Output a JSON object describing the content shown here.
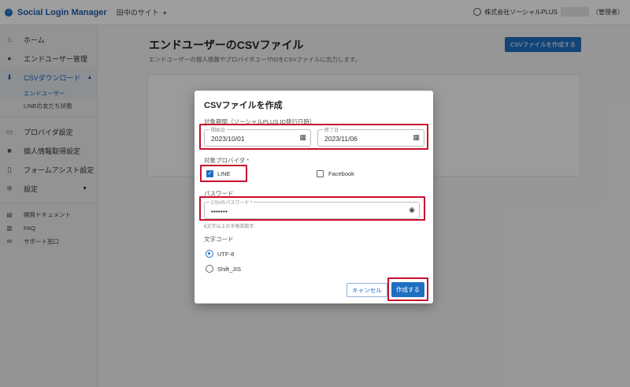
{
  "header": {
    "app_title": "Social Login Manager",
    "site_name": "田中のサイト",
    "account_company": "株式会社ソーシャルPLUS",
    "account_role": "（管理者）"
  },
  "sidebar": {
    "items": [
      {
        "label": "ホーム",
        "icon": "home-icon",
        "glyph": "⌂"
      },
      {
        "label": "エンドユーザー管理",
        "icon": "person-icon",
        "glyph": "●"
      },
      {
        "label": "CSVダウンロード",
        "icon": "download-icon",
        "glyph": "⬇"
      },
      {
        "label": "プロバイダ設定",
        "icon": "monitor-icon",
        "glyph": "▭"
      },
      {
        "label": "個人情報取得設定",
        "icon": "lock-icon",
        "glyph": "■"
      },
      {
        "label": "フォームアシスト設定",
        "icon": "clipboard-icon",
        "glyph": "▯"
      },
      {
        "label": "設定",
        "icon": "gear-icon",
        "glyph": "✲"
      }
    ],
    "subitems": [
      {
        "label": "エンドユーザー"
      },
      {
        "label": "LINEの友だち状態"
      }
    ],
    "footer_items": [
      {
        "label": "開発ドキュメント",
        "icon": "document-icon",
        "glyph": "▤"
      },
      {
        "label": "FAQ",
        "icon": "faq-icon",
        "glyph": "▥"
      },
      {
        "label": "サポート窓口",
        "icon": "mail-icon",
        "glyph": "✉"
      }
    ]
  },
  "main": {
    "title": "エンドユーザーのCSVファイル",
    "subtitle": "エンドユーザーの個人情報やプロバイダユーザIDをCSVファイルに出力します。",
    "create_button": "CSVファイルを作成する"
  },
  "modal": {
    "title": "CSVファイルを作成",
    "period_label": "対象期間（ソーシャルPLUS ID発行日時）",
    "start_label": "開始日",
    "start_value": "2023/10/01",
    "end_label": "終了日",
    "end_value": "2023/11/06",
    "provider_label": "対象プロバイダ *",
    "providers": [
      {
        "label": "LINE",
        "checked": true
      },
      {
        "label": "Facebook",
        "checked": false
      }
    ],
    "password_label": "パスワード",
    "password_field_label": "CSVのパスワード *",
    "password_value": "•••••••",
    "password_hint": "6文字以上の半角英数字",
    "encoding_label": "文字コード",
    "encodings": [
      {
        "label": "UTF-8",
        "checked": true
      },
      {
        "label": "Shift_JIS",
        "checked": false
      }
    ],
    "cancel_label": "キャンセル",
    "submit_label": "作成する"
  },
  "colors": {
    "accent": "#1f6fc1",
    "highlight": "#c8102e"
  }
}
